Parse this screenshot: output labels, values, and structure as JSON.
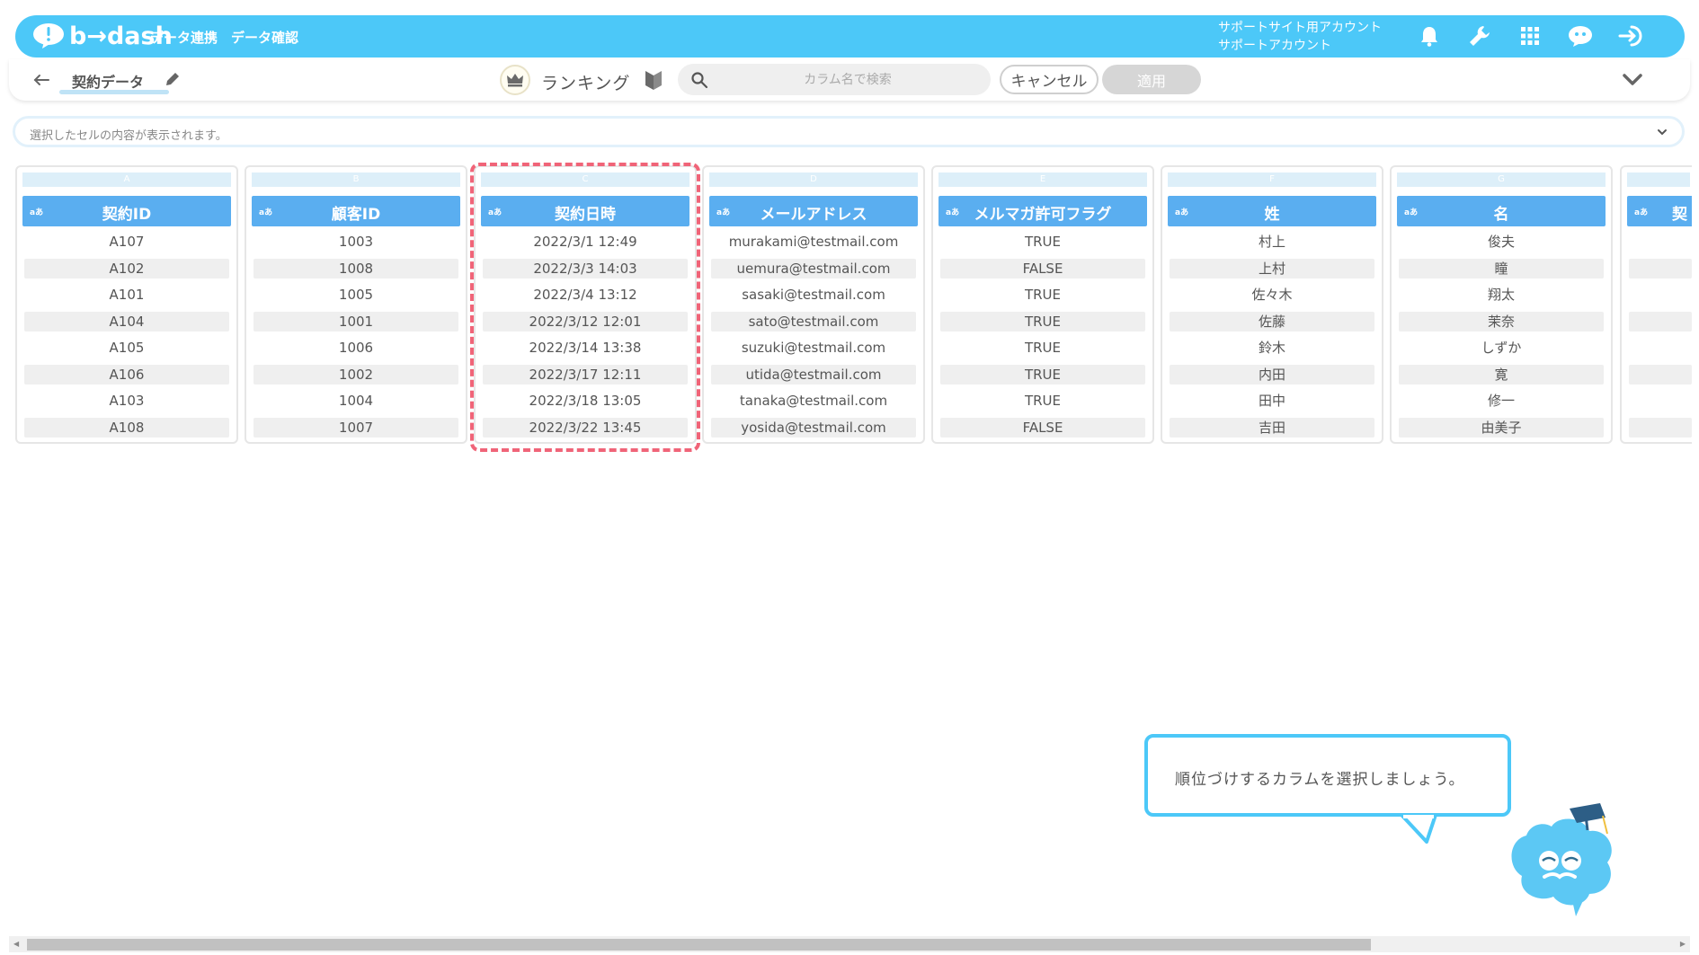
{
  "topbar": {
    "brand": "b→dash",
    "nav": [
      "データ連携",
      "データ確認"
    ],
    "account_line1": "サポートサイト用アカウント",
    "account_line2": "サポートアカウント"
  },
  "toolbar": {
    "sheet_title": "契約データ",
    "mode_label": "ランキング",
    "search_placeholder": "カラム名で検索",
    "cancel_label": "キャンセル",
    "apply_label": "適用"
  },
  "cellbar": {
    "placeholder": "選択したセルの内容が表示されます。"
  },
  "table": {
    "type_badge": "aあ",
    "columns": [
      {
        "letter": "A",
        "name": "契約ID",
        "cells": [
          "A107",
          "A102",
          "A101",
          "A104",
          "A105",
          "A106",
          "A103",
          "A108"
        ]
      },
      {
        "letter": "B",
        "name": "顧客ID",
        "cells": [
          "1003",
          "1008",
          "1005",
          "1001",
          "1006",
          "1002",
          "1004",
          "1007"
        ]
      },
      {
        "letter": "C",
        "name": "契約日時",
        "cells": [
          "2022/3/1 12:49",
          "2022/3/3 14:03",
          "2022/3/4 13:12",
          "2022/3/12 12:01",
          "2022/3/14 13:38",
          "2022/3/17 12:11",
          "2022/3/18 13:05",
          "2022/3/22 13:45"
        ]
      },
      {
        "letter": "D",
        "name": "メールアドレス",
        "cells": [
          "murakami@testmail.com",
          "uemura@testmail.com",
          "sasaki@testmail.com",
          "sato@testmail.com",
          "suzuki@testmail.com",
          "utida@testmail.com",
          "tanaka@testmail.com",
          "yosida@testmail.com"
        ]
      },
      {
        "letter": "E",
        "name": "メルマガ許可フラグ",
        "cells": [
          "TRUE",
          "FALSE",
          "TRUE",
          "TRUE",
          "TRUE",
          "TRUE",
          "TRUE",
          "FALSE"
        ]
      },
      {
        "letter": "F",
        "name": "姓",
        "cells": [
          "村上",
          "上村",
          "佐々木",
          "佐藤",
          "鈴木",
          "内田",
          "田中",
          "吉田"
        ]
      },
      {
        "letter": "G",
        "name": "名",
        "cells": [
          "俊夫",
          "瞳",
          "翔太",
          "茉奈",
          "しずか",
          "寛",
          "修一",
          "由美子"
        ]
      }
    ],
    "partial_column_name": "契"
  },
  "helper": {
    "message": "順位づけするカラムを選択しましょう。"
  },
  "colors": {
    "brand": "#4cc8f8",
    "header": "#5aaef0",
    "highlight": "#f06478"
  },
  "icons": [
    "bell-icon",
    "wrench-icon",
    "grid-icon",
    "chat-bot-icon",
    "logout-icon",
    "back-arrow-icon",
    "pencil-icon",
    "crown-icon",
    "beginner-mark-icon",
    "search-icon",
    "chevron-down-icon"
  ]
}
